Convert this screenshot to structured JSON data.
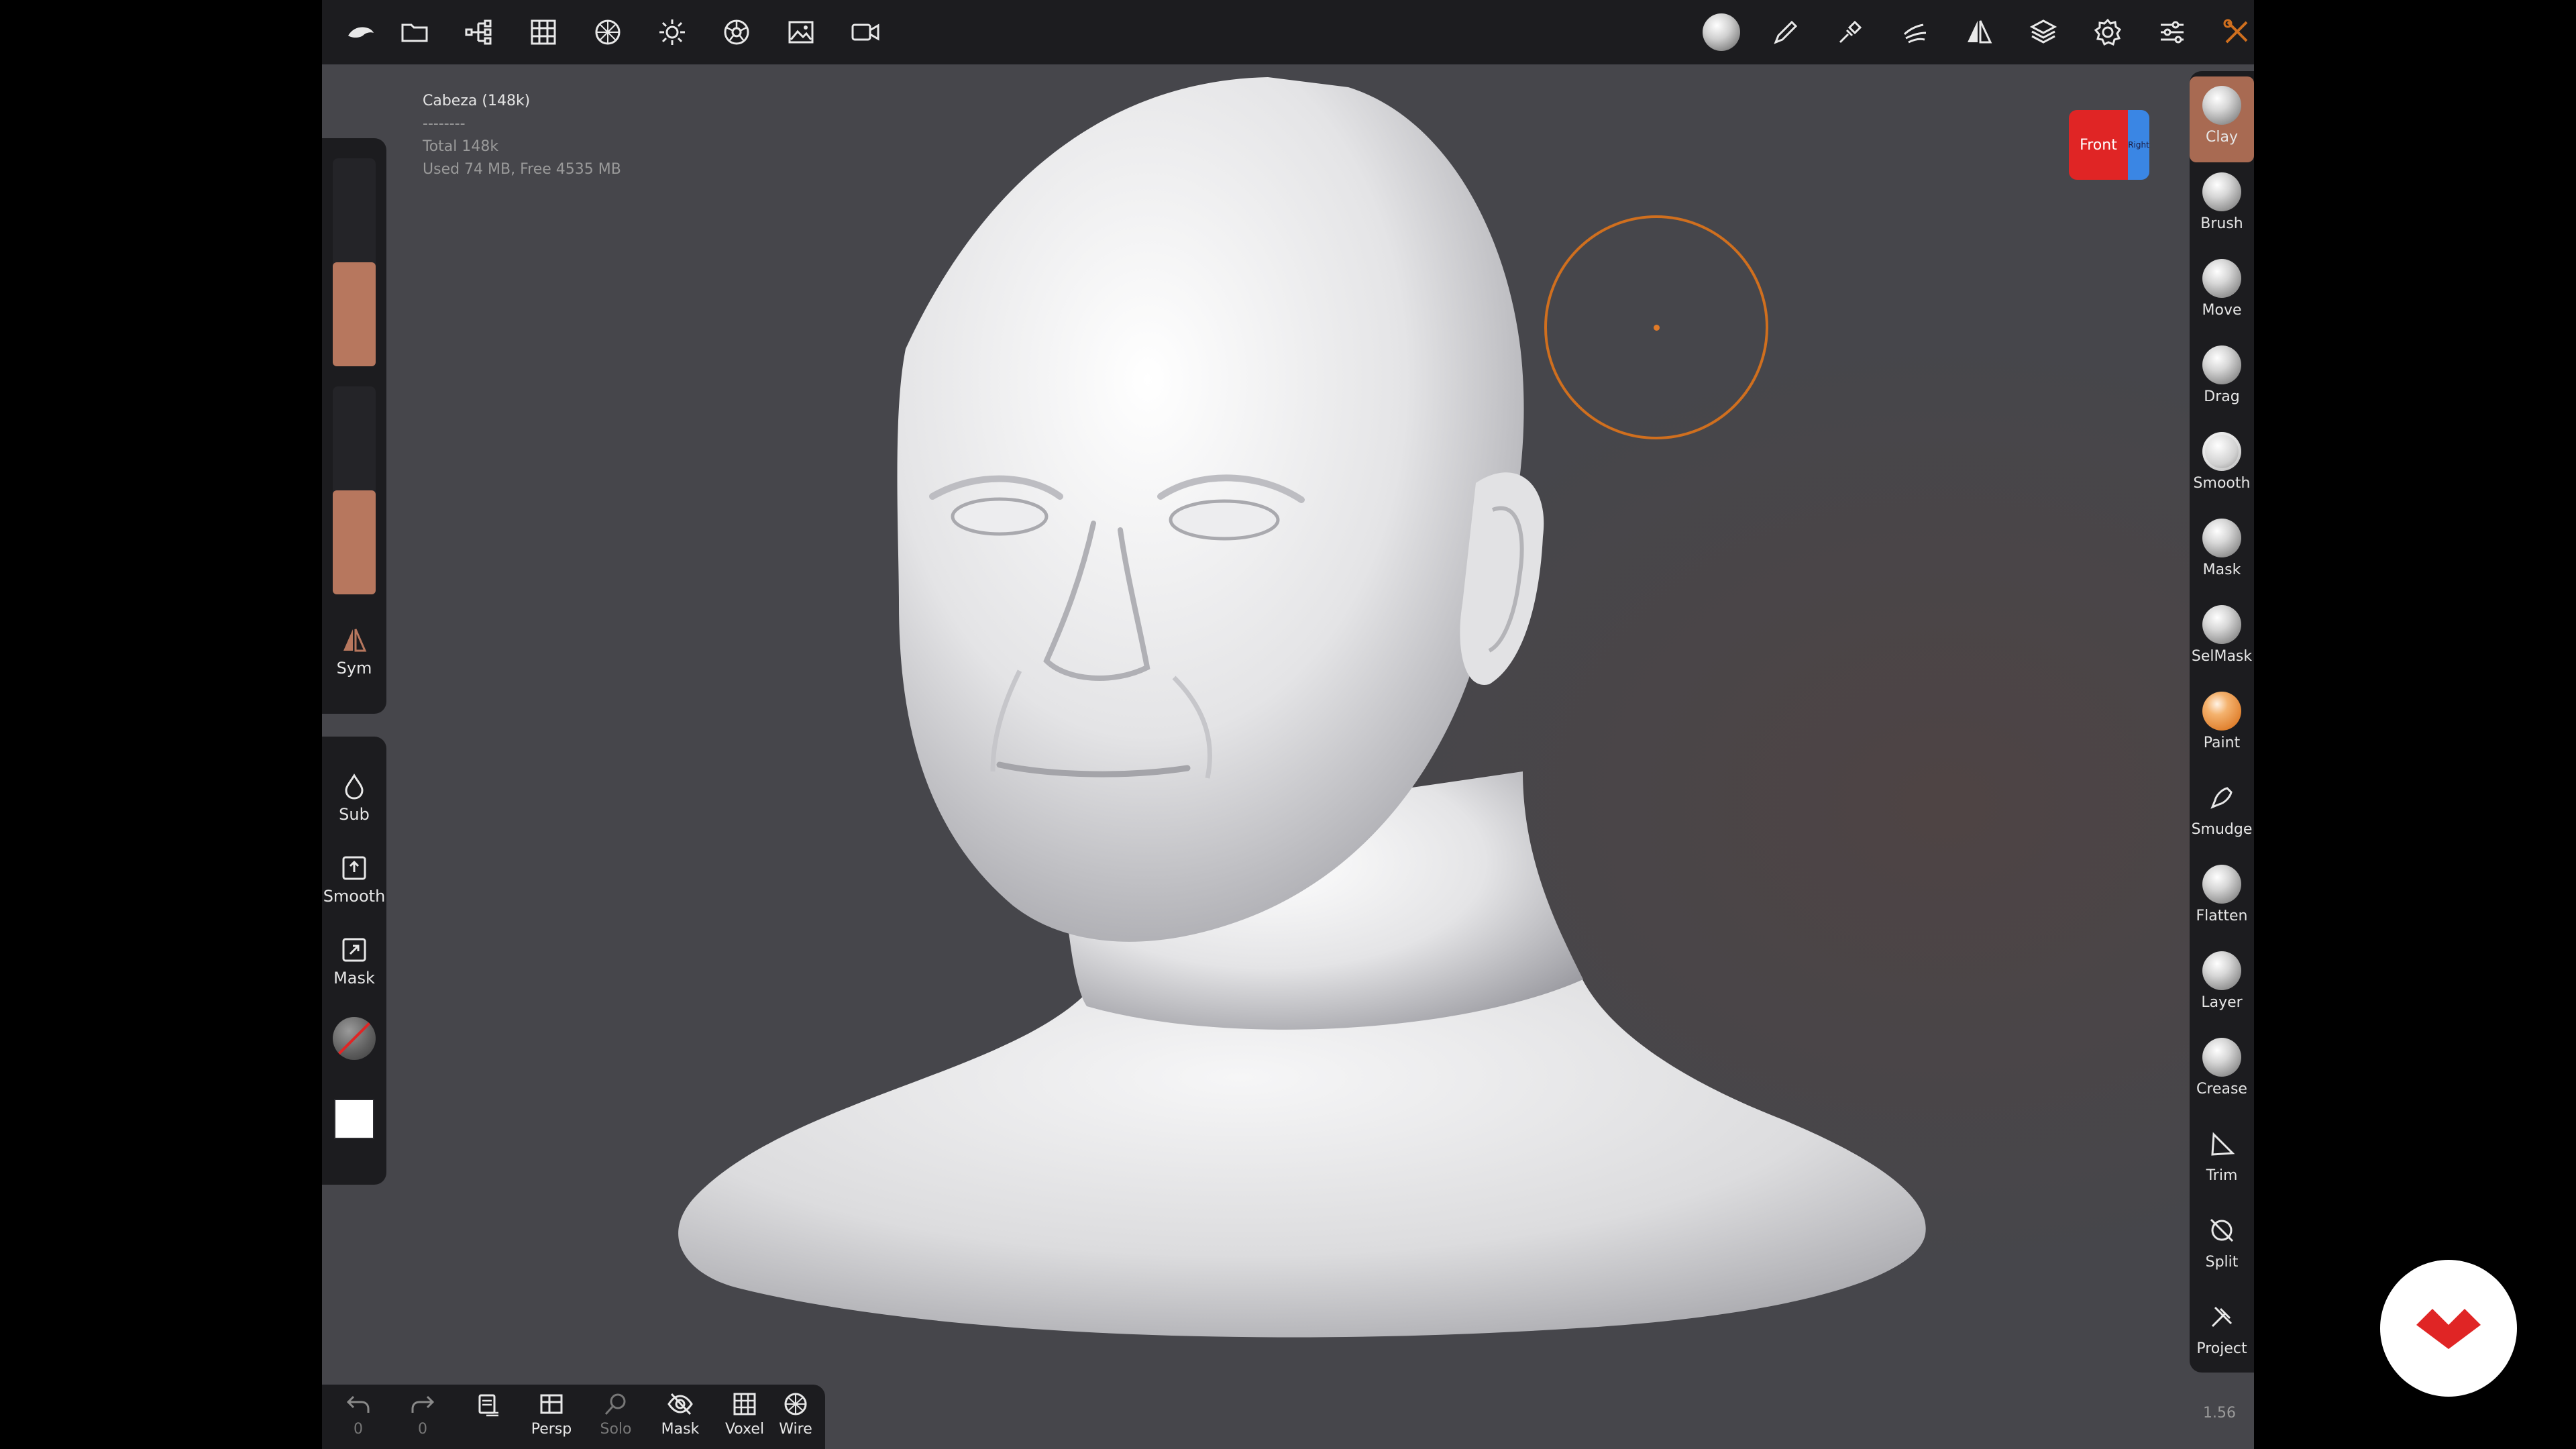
{
  "top_toolbar": {
    "left_icons": [
      "app-logo-icon",
      "folder-icon",
      "scene-tree-icon",
      "grid-icon",
      "topology-icon",
      "light-icon",
      "material-icon",
      "background-image-icon",
      "video-icon"
    ],
    "right_icons": [
      "material-sphere-icon",
      "paint-pen-icon",
      "pick-icon",
      "hand-icon",
      "symmetry-icon",
      "layers-icon",
      "settings-icon",
      "sliders-icon",
      "tools-icon"
    ]
  },
  "scene_info": {
    "object": "Cabeza (148k)",
    "separator": "--------",
    "total": "Total 148k",
    "memory": "Used 74 MB,  Free 4535 MB"
  },
  "left_panel": {
    "radius_level": 0.5,
    "intensity_level": 0.5,
    "sym_label": "Sym",
    "sub_label": "Sub",
    "smooth_label": "Smooth",
    "mask_label": "Mask"
  },
  "right_tools": [
    {
      "label": "Clay",
      "active": true
    },
    {
      "label": "Brush"
    },
    {
      "label": "Move"
    },
    {
      "label": "Drag"
    },
    {
      "label": "Smooth"
    },
    {
      "label": "Mask"
    },
    {
      "label": "SelMask"
    },
    {
      "label": "Paint"
    },
    {
      "label": "Smudge"
    },
    {
      "label": "Flatten"
    },
    {
      "label": "Layer"
    },
    {
      "label": "Crease"
    },
    {
      "label": "Trim"
    },
    {
      "label": "Split"
    },
    {
      "label": "Project"
    }
  ],
  "bottom_bar": {
    "undo_count": "0",
    "redo_count": "0",
    "persp": "Persp",
    "solo": "Solo",
    "mask": "Mask",
    "voxel": "Voxel",
    "wire": "Wire"
  },
  "nav_cube": {
    "front": "Front",
    "right": "Right"
  },
  "zoom": "1.56",
  "colors": {
    "accent": "#b7775e",
    "panel": "#1c1c1f",
    "viewport": "#46464b",
    "brush_ring": "#d06f1e",
    "logo": "#e02525"
  }
}
